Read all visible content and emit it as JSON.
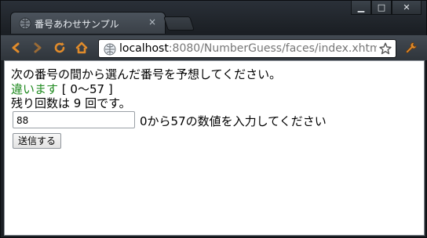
{
  "window": {
    "minimize": "▁",
    "maximize": "□",
    "close": "✕"
  },
  "tab": {
    "title": "番号あわせサンプル",
    "close": "×"
  },
  "toolbar": {
    "back_icon": "arrow-left",
    "forward_icon": "arrow-right",
    "reload_icon": "reload",
    "home_icon": "home",
    "wrench_icon": "wrench"
  },
  "address": {
    "host": "localhost",
    "rest": ":8080/NumberGuess/faces/index.xhtml"
  },
  "page": {
    "instruction": "次の番号の間から選んだ番号を予想してください。",
    "wrong_label": "違います",
    "range": "[ 0〜57 ]",
    "remaining": "残り回数は 9 回です。",
    "input_value": "88",
    "error": "0から57の数値を入力してください",
    "submit": "送信する"
  },
  "colors": {
    "wrong": "#1f8a1f",
    "error": "#d10000"
  }
}
